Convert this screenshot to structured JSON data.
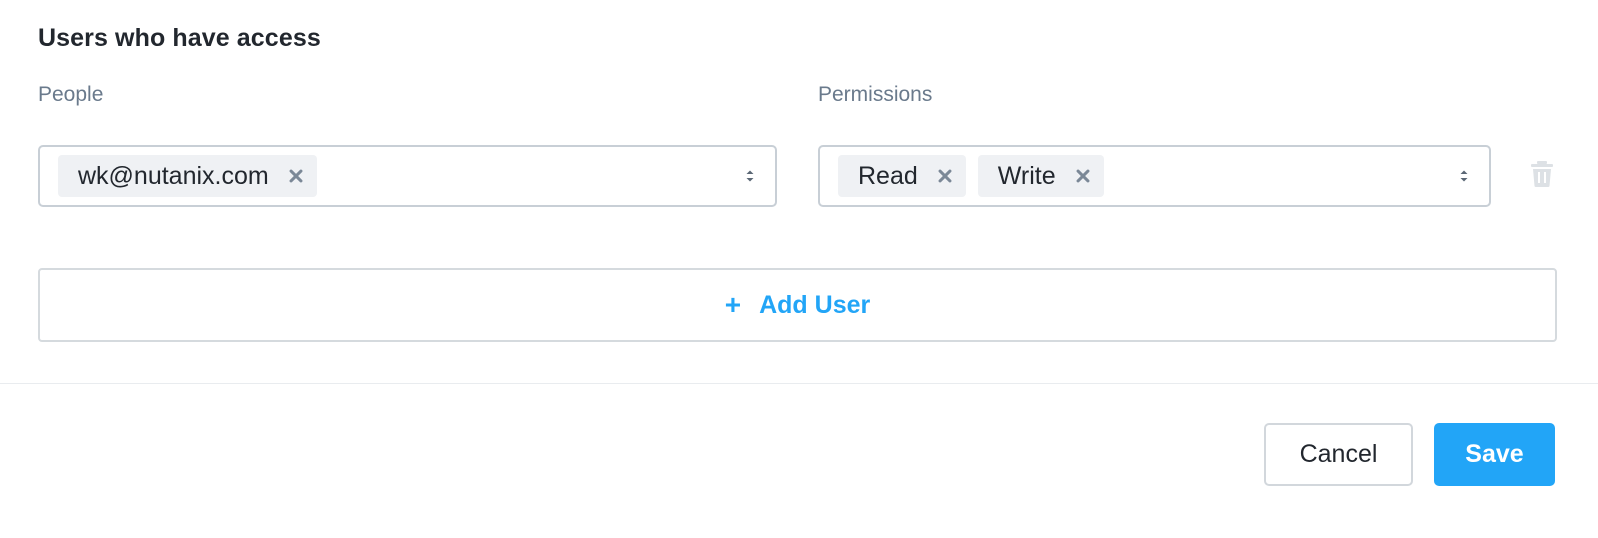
{
  "section": {
    "title": "Users who have access"
  },
  "columns": {
    "people": "People",
    "permissions": "Permissions"
  },
  "people_field": {
    "tags": [
      {
        "label": "wk@nutanix.com"
      }
    ],
    "remove_icon": "close-icon",
    "dropdown_icon": "chevron-up-down-icon"
  },
  "permissions_field": {
    "tags": [
      {
        "label": "Read"
      },
      {
        "label": "Write"
      }
    ],
    "remove_icon": "close-icon",
    "dropdown_icon": "chevron-up-down-icon"
  },
  "row_actions": {
    "delete_icon": "trash-icon"
  },
  "add_user": {
    "icon": "+",
    "label": "Add User"
  },
  "footer": {
    "cancel_label": "Cancel",
    "save_label": "Save"
  },
  "colors": {
    "accent": "#22a5f7",
    "label": "#6a7a8c",
    "tag_bg": "#eff1f4"
  }
}
